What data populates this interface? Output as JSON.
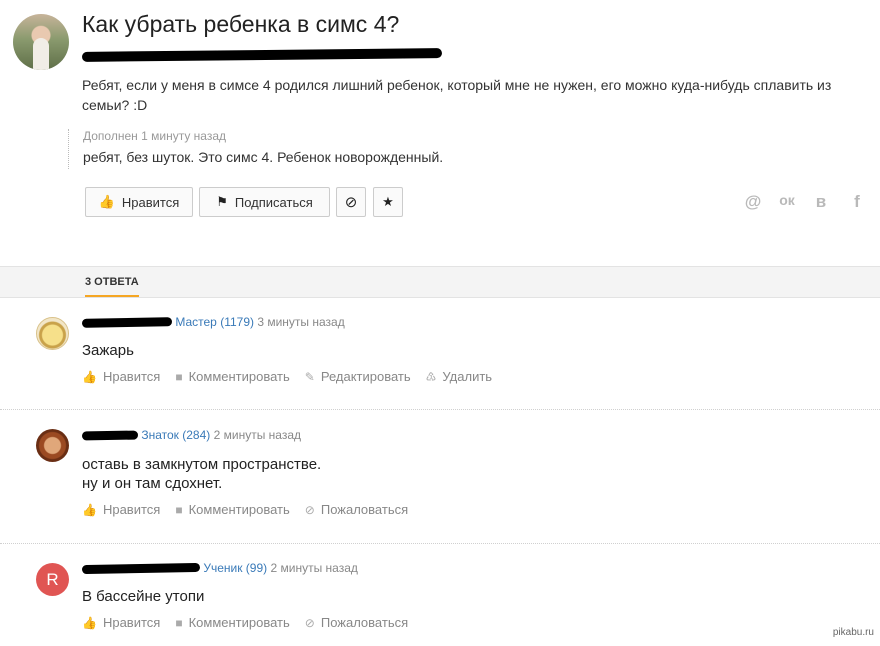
{
  "question": {
    "title": "Как убрать ребенка в симс 4?",
    "text": "Ребят, если у меня в симсе 4 родился лишний ребенок, который мне не нужен, его можно куда-нибудь сплавить из семьи? :D",
    "addendum_label": "Дополнен 1 минуту назад",
    "addendum_text": "ребят, без шуток. Это симс 4. Ребенок новорожденный."
  },
  "actions": {
    "like_label": "Нравится",
    "subscribe_label": "Подписаться",
    "like_icon": "thumbs-up-icon",
    "subscribe_icon": "bookmark-icon",
    "block_icon": "block-icon",
    "favorite_icon": "star-icon"
  },
  "share": {
    "items": [
      "@",
      "ок",
      "в",
      "f"
    ]
  },
  "tabs": {
    "answers_label": "3 ОТВЕТА"
  },
  "answers": [
    {
      "rank": "Мастер (1179)",
      "time": "3 минуты назад",
      "text": "Зажарь",
      "actions": [
        "Нравится",
        "Комментировать",
        "Редактировать",
        "Удалить"
      ]
    },
    {
      "rank": "Знаток (284)",
      "time": "2 минуты назад",
      "text": "оставь в замкнутом пространстве.\nну и он там сдохнет.",
      "actions": [
        "Нравится",
        "Комментировать",
        "Пожаловаться"
      ]
    },
    {
      "avatar_letter": "R",
      "rank": "Ученик (99)",
      "time": "2 минуты назад",
      "text": "В бассейне утопи",
      "actions": [
        "Нравится",
        "Комментировать",
        "Пожаловаться"
      ]
    }
  ],
  "colors": {
    "accent": "#f5a623",
    "rank_link": "#3a7ab8",
    "avatar_r": "#e05553"
  },
  "watermark": "pikabu.ru"
}
